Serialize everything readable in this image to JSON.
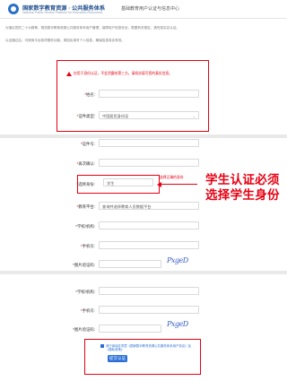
{
  "header": {
    "brand": "国家数字教育资源 · 公共服务体系",
    "brand_sub": "National Public Service Platform for Education Resources",
    "title": "基础教育用户认证与信息中心"
  },
  "notice": {
    "line1": "为落实党的二十大精神，规范数字教育资源公共服务体系用户管理，保障用户信息安全，根据有关规定，请完成实名认证。",
    "line2": "认证通过后，可使用平台各项服务功能。请如实填写个人信息，确保信息真实有效。"
  },
  "form1": {
    "warning": "仅用于身份认证，不会泄露给第三方。请如实填写您的真实信息。",
    "name_label": "姓名:",
    "id_type_label": "证件类型:",
    "id_type_value": "中国居民身份证"
  },
  "form2": {
    "id_number_label": "证件号:",
    "verify_label": "再次确认:",
    "identity_label": "*选择身份:",
    "identity_value": "学生",
    "identity_hint": "选择正确的身份",
    "platform_label": "教育平台:",
    "platform_placeholder": "查询并选择教育人员数据平台",
    "school_label": "*学校/机构:",
    "phone_label": "手机号:",
    "captcha_label": "*图片验证码:",
    "captcha_text": "PxgeD"
  },
  "annotation": {
    "line1": "学生认证必须",
    "line2": "选择学生身份"
  },
  "form3": {
    "school_label": "*学校/机构:",
    "phone_label": "手机号:",
    "captcha_label": "*图片验证码:",
    "captcha_text": "PxgeD",
    "agree_text": "请已阅读并同意《国家数字教育资源公共服务体系用户协议》及《隐私政策》",
    "submit_label": "提交认证"
  }
}
